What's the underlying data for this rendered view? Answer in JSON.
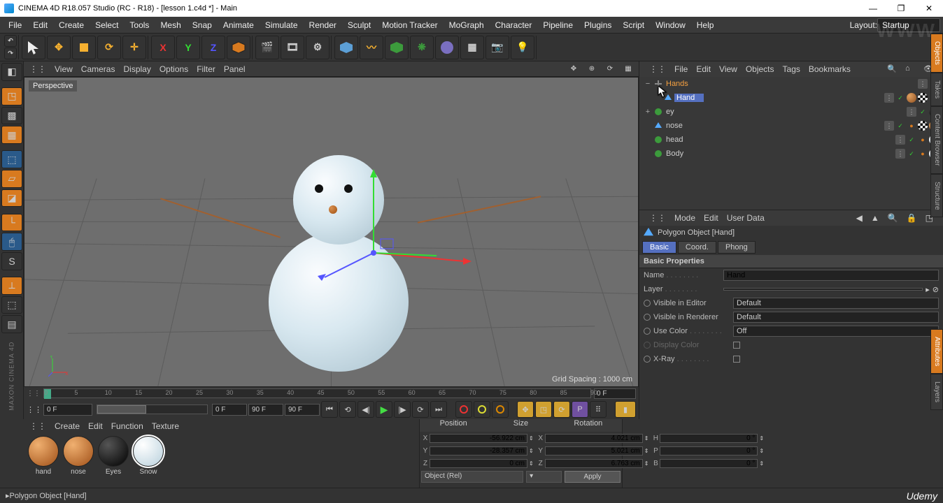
{
  "window": {
    "title": "CINEMA 4D R18.057 Studio (RC - R18) - [lesson 1.c4d *] - Main",
    "min": "—",
    "max": "❐",
    "close": "✕"
  },
  "menubar": [
    "File",
    "Edit",
    "Create",
    "Select",
    "Tools",
    "Mesh",
    "Snap",
    "Animate",
    "Simulate",
    "Render",
    "Sculpt",
    "Motion Tracker",
    "MoGraph",
    "Character",
    "Pipeline",
    "Plugins",
    "Script",
    "Window",
    "Help"
  ],
  "layout_label": "Layout:",
  "layout_value": "Startup",
  "vpmenu": [
    "View",
    "Cameras",
    "Display",
    "Options",
    "Filter",
    "Panel"
  ],
  "view_label": "Perspective",
  "grid_spacing": "Grid Spacing : 1000 cm",
  "timeline": {
    "ticks": [
      "0",
      "5",
      "10",
      "15",
      "20",
      "25",
      "30",
      "35",
      "40",
      "45",
      "50",
      "55",
      "60",
      "65",
      "70",
      "75",
      "80",
      "85",
      "90"
    ],
    "cur_field": "0 F",
    "range_start": "0 F",
    "range_mid": "0 F",
    "range_end_a": "90 F",
    "range_end_b": "90 F"
  },
  "object_manager": {
    "menu": [
      "File",
      "Edit",
      "View",
      "Objects",
      "Tags",
      "Bookmarks"
    ],
    "rows": [
      {
        "name": "Hands",
        "type": "null",
        "indent": 0,
        "highlight": "hot",
        "expand": "−",
        "mats": []
      },
      {
        "name": "Hand",
        "type": "poly",
        "indent": 1,
        "highlight": "sel",
        "expand": "",
        "mats": [
          "wood",
          "chk",
          "dot"
        ]
      },
      {
        "name": "ey",
        "type": "sphere",
        "indent": 0,
        "highlight": "",
        "expand": "+",
        "mats": [
          "blk"
        ]
      },
      {
        "name": "nose",
        "type": "poly",
        "indent": 0,
        "highlight": "",
        "expand": "",
        "mats": [
          "dot",
          "chk",
          "wood"
        ]
      },
      {
        "name": "head",
        "type": "sphere",
        "indent": 0,
        "highlight": "",
        "expand": "",
        "mats": [
          "dot",
          "snow"
        ]
      },
      {
        "name": "Body",
        "type": "sphere",
        "indent": 0,
        "highlight": "",
        "expand": "",
        "mats": [
          "dot",
          "snow"
        ]
      }
    ]
  },
  "attributes": {
    "menu": [
      "Mode",
      "Edit",
      "User Data"
    ],
    "object_title": "Polygon Object [Hand]",
    "tabs": [
      "Basic",
      "Coord.",
      "Phong"
    ],
    "group": "Basic Properties",
    "props": {
      "name_label": "Name",
      "name_value": "Hand",
      "layer_label": "Layer",
      "layer_value": "",
      "vis_editor_label": "Visible in Editor",
      "vis_editor_value": "Default",
      "vis_render_label": "Visible in Renderer",
      "vis_render_value": "Default",
      "use_color_label": "Use Color",
      "use_color_value": "Off",
      "display_color_label": "Display Color",
      "xray_label": "X-Ray"
    }
  },
  "materials": {
    "menu": [
      "Create",
      "Edit",
      "Function",
      "Texture"
    ],
    "items": [
      {
        "name": "hand",
        "style": "wood"
      },
      {
        "name": "nose",
        "style": "wood"
      },
      {
        "name": "Eyes",
        "style": "blk"
      },
      {
        "name": "Snow",
        "style": "snow",
        "sel": true
      }
    ]
  },
  "coords": {
    "headers": [
      "Position",
      "Size",
      "Rotation"
    ],
    "rows": [
      {
        "a": "X",
        "av": "-56.922 cm",
        "b": "X",
        "bv": "4.021 cm",
        "c": "H",
        "cv": "0 °"
      },
      {
        "a": "Y",
        "av": "-28.357 cm",
        "b": "Y",
        "bv": "5.021 cm",
        "c": "P",
        "cv": "0 °"
      },
      {
        "a": "Z",
        "av": "0 cm",
        "b": "Z",
        "bv": "6.763 cm",
        "c": "B",
        "cv": "0 °"
      }
    ],
    "mode": "Object (Rel)",
    "apply": "Apply"
  },
  "right_tabs": [
    "Objects",
    "Takes",
    "Content Browser",
    "Structure",
    "Attributes",
    "Layers"
  ],
  "status_text": "Polygon Object [Hand]",
  "udemy": "Udemy",
  "watermark": "WWW"
}
